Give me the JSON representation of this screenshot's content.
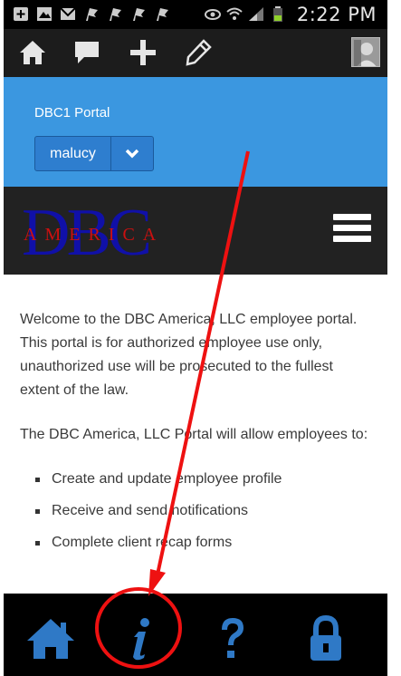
{
  "status_bar": {
    "time": "2:22 PM",
    "left_icons": [
      "plus-box-icon",
      "image-icon",
      "mail-icon",
      "flag-icon",
      "flag-icon",
      "flag-icon",
      "flag-icon"
    ],
    "right_icons": [
      "eye-icon",
      "wifi-icon",
      "signal-icon",
      "battery-icon"
    ]
  },
  "toolbar": {
    "items": [
      "home-icon",
      "comment-icon",
      "add-icon",
      "pencil-icon"
    ]
  },
  "header": {
    "portal_title": "DBC1 Portal",
    "user_select_value": "malucy"
  },
  "brand": {
    "logo_letters": "DBC",
    "logo_sub": "AMERICA"
  },
  "content": {
    "paragraph1": "Welcome to the DBC America, LLC employee portal. This portal is for authorized employee use only, unauthorized use will be prosecuted to the fullest extent of the law.",
    "paragraph2": "The DBC America, LLC Portal will allow employees to:",
    "list": [
      "Create and update employee profile",
      "Receive and send notifications",
      "Complete client recap forms"
    ]
  },
  "bottom_nav": {
    "items": [
      "home-icon",
      "info-icon",
      "help-icon",
      "lock-icon"
    ]
  },
  "colors": {
    "header_blue": "#3b97e0",
    "nav_icon_blue": "#2f79c6",
    "annotation_red": "#ee1111"
  }
}
